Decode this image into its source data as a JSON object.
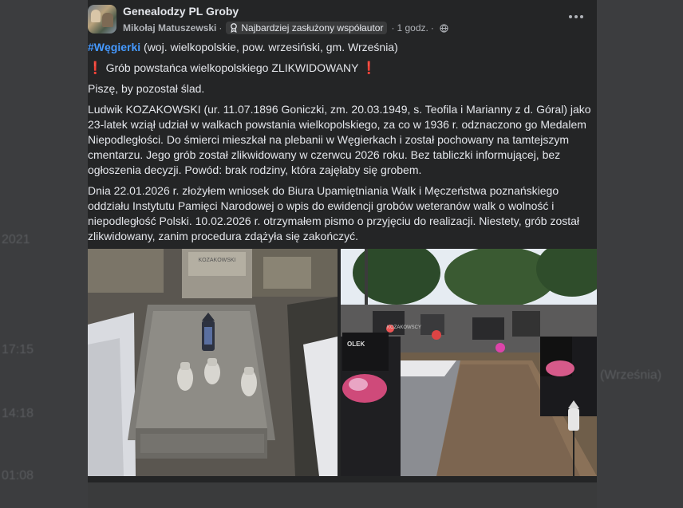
{
  "post": {
    "group_name": "Genealodzy PL Groby",
    "author": "Mikołaj Matuszewski",
    "badge": "Najbardziej zasłużony współautor",
    "time": "1 godz.",
    "sep": "·",
    "hashtag": "#Węgierki",
    "location": " (woj. wielkopolskie, pow. wrzesiński, gm. Września)",
    "headline": "Grób powstańca wielkopolskiego ZLIKWIDOWANY",
    "excl": "❗",
    "p_intro": "Piszę, by pozostał ślad.",
    "p_bio": "Ludwik KOZAKOWSKI (ur. 11.07.1896 Goniczki, zm. 20.03.1949, s. Teofila i Marianny z d. Góral) jako 23-latek wziął udział w walkach powstania wielkopolskiego, za co w 1936 r. odznaczono go Medalem Niepodległości. Do śmierci mieszkał na plebanii w Węgierkach i został pochowany na tamtejszym cmentarzu. Jego grób został zlikwidowany w czerwcu 2026 roku. Bez tabliczki informującej, bez ogłoszenia decyzji. Powód: brak rodziny, która zajęłaby się grobem.",
    "p_request": "Dnia 22.01.2026 r. złożyłem wniosek do Biura Upamiętniania Walk i Męczeństwa poznańskiego oddziału Instytutu Pamięci Narodowej o wpis do ewidencji grobów weteranów walk o wolność i niepodległość Polski. 10.02.2026 r. otrzymałem pismo o przyjęciu do realizacji. Niestety, grób został zlikwidowany, zanim procedura zdążyła się zakończyć.",
    "photo_left_plaque": "KOZAKOWSKI",
    "photo_right_plaque_1": "OLEK",
    "photo_right_plaque_2": "KOZAKOWSCY"
  },
  "background": {
    "frag_1": "2021",
    "frag_2": "17:15",
    "frag_3": "14:18",
    "frag_4": "01:08",
    "frag_5": "(Września)"
  },
  "icons": {
    "more": "more-options-icon",
    "badge": "contributor-badge-icon",
    "privacy": "globe-icon"
  },
  "colors": {
    "card_bg": "#242526",
    "page_bg": "#3a3b3c",
    "hashtag": "#4599ff",
    "text": "#e4e6eb",
    "muted": "#b0b3b8"
  }
}
